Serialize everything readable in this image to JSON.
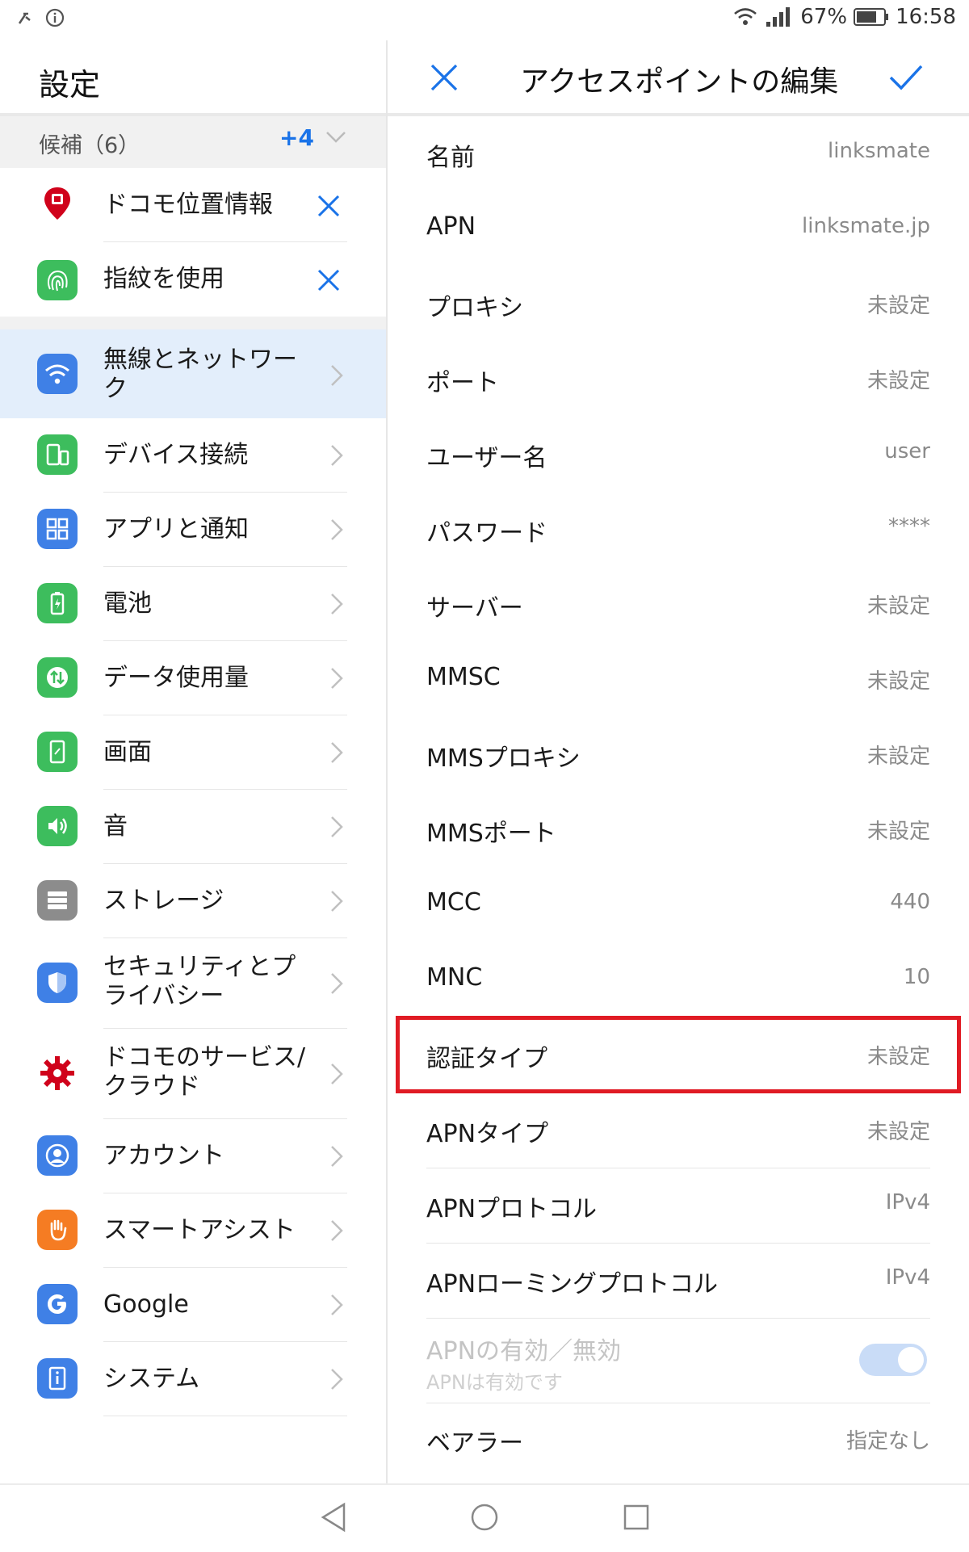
{
  "status_bar": {
    "battery": "67%",
    "time": "16:58",
    "icons": [
      "usb-debug-icon",
      "info-icon",
      "wifi-icon",
      "signal-icon",
      "battery-icon"
    ]
  },
  "left_pane": {
    "title": "設定",
    "candidates": {
      "label": "候補（6）",
      "more": "+4"
    },
    "suggestions": [
      {
        "label": "ドコモ位置情報",
        "icon": "location-pin-icon",
        "color": "#d0021b"
      },
      {
        "label": "指紋を使用",
        "icon": "fingerprint-icon",
        "color": "#3dbd5d"
      }
    ],
    "items": [
      {
        "label": "無線とネットワーク",
        "icon": "wifi-icon",
        "color": "#3f80e6",
        "selected": true
      },
      {
        "label": "デバイス接続",
        "icon": "device-connection-icon",
        "color": "#3dbd5d"
      },
      {
        "label": "アプリと通知",
        "icon": "apps-grid-icon",
        "color": "#3f80e6"
      },
      {
        "label": "電池",
        "icon": "battery-icon",
        "color": "#3dbd5d"
      },
      {
        "label": "データ使用量",
        "icon": "data-usage-icon",
        "color": "#3dbd5d"
      },
      {
        "label": "画面",
        "icon": "display-icon",
        "color": "#3dbd5d"
      },
      {
        "label": "音",
        "icon": "sound-icon",
        "color": "#3dbd5d"
      },
      {
        "label": "ストレージ",
        "icon": "storage-icon",
        "color": "#8c8c8c"
      },
      {
        "label": "セキュリティとプライバシー",
        "icon": "shield-icon",
        "color": "#3f80e6"
      },
      {
        "label": "ドコモのサービス/クラウド",
        "icon": "gear-icon",
        "color": "#d0021b"
      },
      {
        "label": "アカウント",
        "icon": "account-icon",
        "color": "#3f80e6"
      },
      {
        "label": "スマートアシスト",
        "icon": "hand-icon",
        "color": "#f57c23"
      },
      {
        "label": "Google",
        "icon": "google-icon",
        "color": "#3f80e6"
      },
      {
        "label": "システム",
        "icon": "system-info-icon",
        "color": "#3f80e6"
      }
    ]
  },
  "right_pane": {
    "title": "アクセスポイントの編集",
    "fields": [
      {
        "name": "名前",
        "value": "linksmate"
      },
      {
        "name": "APN",
        "value": "linksmate.jp"
      },
      {
        "name": "プロキシ",
        "value": "未設定"
      },
      {
        "name": "ポート",
        "value": "未設定"
      },
      {
        "name": "ユーザー名",
        "value": "user"
      },
      {
        "name": "パスワード",
        "value": "****"
      },
      {
        "name": "サーバー",
        "value": "未設定"
      },
      {
        "name": "MMSC",
        "value": "未設定"
      },
      {
        "name": "MMSプロキシ",
        "value": "未設定"
      },
      {
        "name": "MMSポート",
        "value": "未設定"
      },
      {
        "name": "MCC",
        "value": "440"
      },
      {
        "name": "MNC",
        "value": "10"
      },
      {
        "name": "認証タイプ",
        "value": "未設定"
      },
      {
        "name": "APNタイプ",
        "value": "未設定"
      },
      {
        "name": "APNプロトコル",
        "value": "IPv4"
      },
      {
        "name": "APNローミングプロトコル",
        "value": "IPv4"
      }
    ],
    "apn_toggle": {
      "label": "APNの有効／無効",
      "sub": "APNは有効です",
      "on": true
    },
    "bearer": {
      "name": "ベアラー",
      "value": "指定なし"
    }
  },
  "accent_colors": {
    "blue": "#1a73e8",
    "highlight_red": "#e01b24",
    "selected_bg": "#e3eefb"
  }
}
